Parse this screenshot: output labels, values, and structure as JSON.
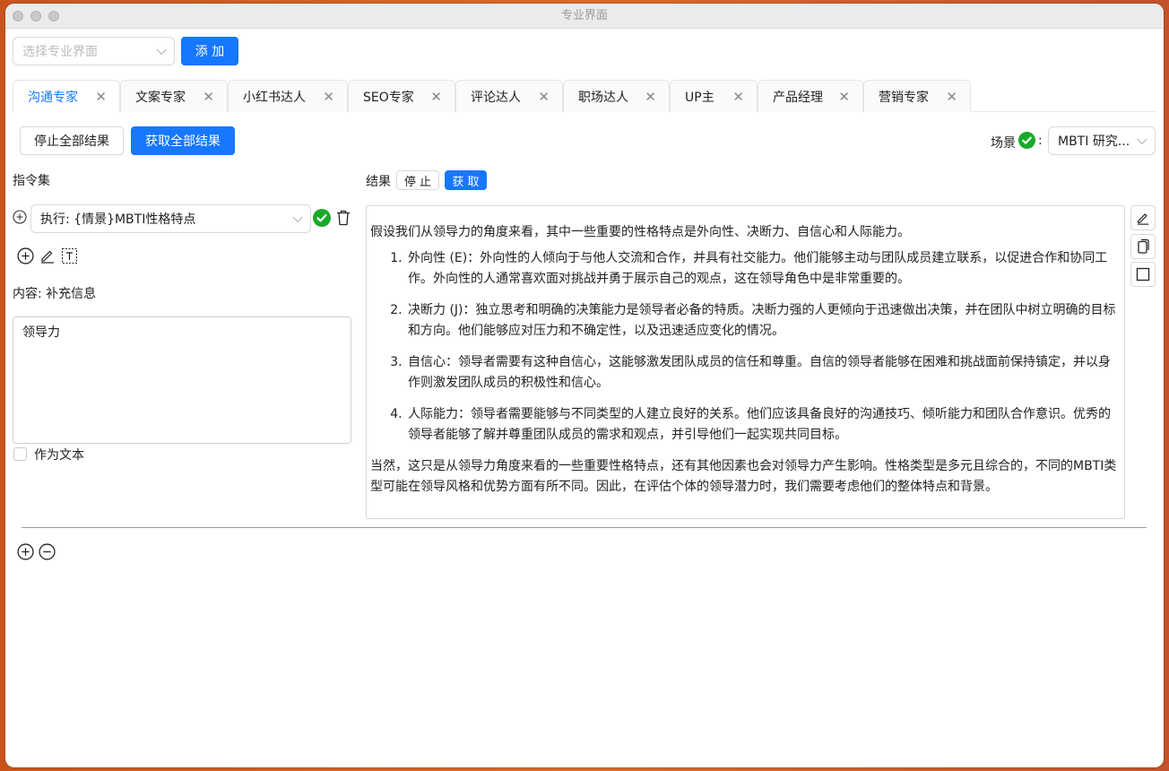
{
  "window": {
    "title": "专业界面"
  },
  "top": {
    "select_placeholder": "选择专业界面",
    "add_label": "添 加"
  },
  "tabs": [
    {
      "label": "沟通专家",
      "active": true
    },
    {
      "label": "文案专家"
    },
    {
      "label": "小红书达人"
    },
    {
      "label": "SEO专家"
    },
    {
      "label": "评论达人"
    },
    {
      "label": "职场达人"
    },
    {
      "label": "UP主"
    },
    {
      "label": "产品经理"
    },
    {
      "label": "营销专家"
    }
  ],
  "actions": {
    "stop_all": "停止全部结果",
    "get_all": "获取全部结果",
    "scene_label": "场景",
    "scene_colon": ":",
    "scene_value": "MBTI 研究..."
  },
  "left": {
    "instruction_set": "指令集",
    "instruction_value": "执行: {情景}MBTI性格特点",
    "content_label": "内容: 补充信息",
    "textarea_value": "领导力",
    "as_text_label": "作为文本"
  },
  "result": {
    "label": "结果",
    "stop": "停 止",
    "get": "获 取",
    "intro": "假设我们从领导力的角度来看，其中一些重要的性格特点是外向性、决断力、自信心和人际能力。",
    "items": [
      "外向性 (E)：外向性的人倾向于与他人交流和合作，并具有社交能力。他们能够主动与团队成员建立联系，以促进合作和协同工作。外向性的人通常喜欢面对挑战并勇于展示自己的观点，这在领导角色中是非常重要的。",
      "决断力 (J)：独立思考和明确的决策能力是领导者必备的特质。决断力强的人更倾向于迅速做出决策，并在团队中树立明确的目标和方向。他们能够应对压力和不确定性，以及迅速适应变化的情况。",
      "自信心：领导者需要有这种自信心，这能够激发团队成员的信任和尊重。自信的领导者能够在困难和挑战面前保持镇定，并以身作则激发团队成员的积极性和信心。",
      "人际能力：领导者需要能够与不同类型的人建立良好的关系。他们应该具备良好的沟通技巧、倾听能力和团队合作意识。优秀的领导者能够了解并尊重团队成员的需求和观点，并引导他们一起实现共同目标。"
    ],
    "outro": "当然，这只是从领导力角度来看的一些重要性格特点，还有其他因素也会对领导力产生影响。性格类型是多元且综合的，不同的MBTI类型可能在领导风格和优势方面有所不同。因此，在评估个体的领导潜力时，我们需要考虑他们的整体特点和背景。"
  },
  "colors": {
    "primary": "#1677ff",
    "success": "#1aaa2a"
  }
}
